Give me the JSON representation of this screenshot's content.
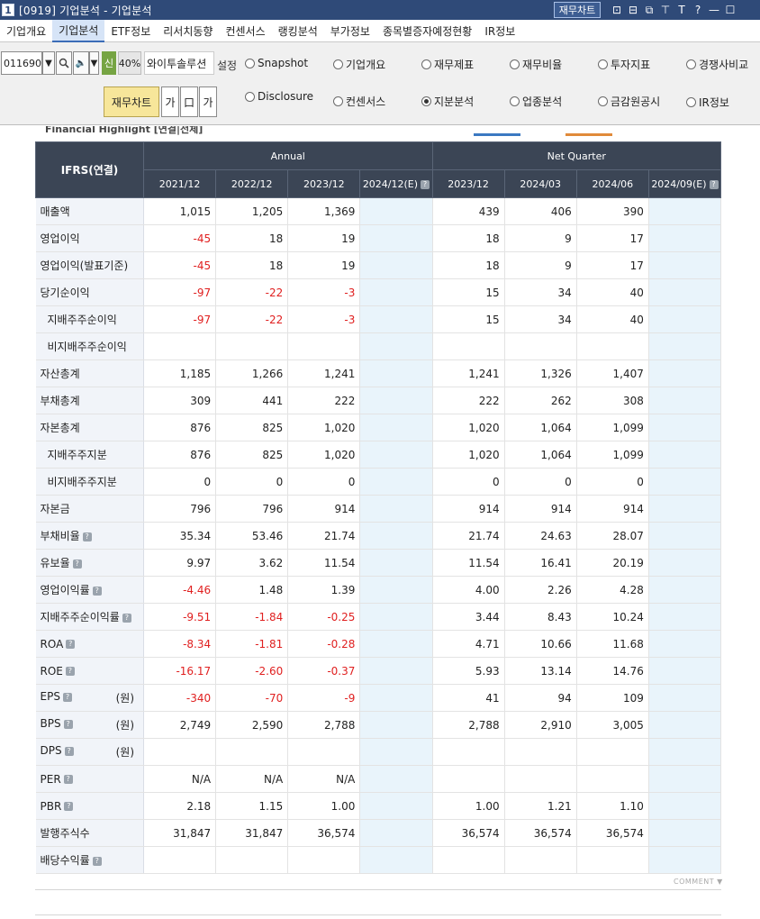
{
  "window": {
    "screen_no": "1",
    "title": "[0919] 기업분석 - 기업분석",
    "fin_chart_button": "재무차트",
    "icons": [
      "chart-icon",
      "layout-icon",
      "copy-icon",
      "pin-icon",
      "font-icon",
      "help-icon",
      "minimize-icon",
      "close-icon"
    ],
    "icon_glyphs": [
      "⊡",
      "⊟",
      "⧉",
      "⊤",
      "T",
      "?",
      "—",
      "☐"
    ]
  },
  "menu": {
    "items": [
      "기업개요",
      "기업분석",
      "ETF정보",
      "리서치동향",
      "컨센서스",
      "랭킹분석",
      "부가정보",
      "종목별증자예정현황",
      "IR정보"
    ],
    "active_index": 1
  },
  "controls": {
    "code": "011690",
    "new_badge": "신",
    "percent": "40%",
    "company": "와이투솔루션",
    "setting": "설정",
    "fin_chart_button": "재무차트",
    "tool_ga1": "가",
    "tool_box": "口",
    "tool_ga2": "가",
    "radios_row1": [
      "Snapshot",
      "기업개요",
      "재무제표",
      "재무비율",
      "투자지표",
      "경쟁사비교"
    ],
    "radios_row2": [
      "Disclosure",
      "컨센서스",
      "지분분석",
      "업종분석",
      "금감원공시",
      "IR정보"
    ],
    "selected": "지분분석"
  },
  "header_strip": "Financial Highlight [연결|전체]",
  "table": {
    "corner": "IFRS(연결)",
    "group_annual": "Annual",
    "group_quarter": "Net Quarter",
    "columns": [
      "2021/12",
      "2022/12",
      "2023/12",
      "2024/12(E)",
      "2023/12",
      "2024/03",
      "2024/06",
      "2024/09(E)"
    ],
    "est_columns": [
      3,
      7
    ],
    "rows": [
      {
        "label": "매출액",
        "indent": false,
        "help": false,
        "unit": "",
        "values": [
          "1,015",
          "1,205",
          "1,369",
          "",
          "439",
          "406",
          "390",
          ""
        ]
      },
      {
        "label": "영업이익",
        "indent": false,
        "help": false,
        "unit": "",
        "values": [
          "-45",
          "18",
          "19",
          "",
          "18",
          "9",
          "17",
          ""
        ]
      },
      {
        "label": "영업이익(발표기준)",
        "indent": false,
        "help": false,
        "unit": "",
        "values": [
          "-45",
          "18",
          "19",
          "",
          "18",
          "9",
          "17",
          ""
        ]
      },
      {
        "label": "당기순이익",
        "indent": false,
        "help": false,
        "unit": "",
        "values": [
          "-97",
          "-22",
          "-3",
          "",
          "15",
          "34",
          "40",
          ""
        ]
      },
      {
        "label": "지배주주순이익",
        "indent": true,
        "help": false,
        "unit": "",
        "values": [
          "-97",
          "-22",
          "-3",
          "",
          "15",
          "34",
          "40",
          ""
        ]
      },
      {
        "label": "비지배주주순이익",
        "indent": true,
        "help": false,
        "unit": "",
        "values": [
          "",
          "",
          "",
          "",
          "",
          "",
          "",
          ""
        ]
      },
      {
        "label": "자산총계",
        "indent": false,
        "help": false,
        "unit": "",
        "values": [
          "1,185",
          "1,266",
          "1,241",
          "",
          "1,241",
          "1,326",
          "1,407",
          ""
        ]
      },
      {
        "label": "부채총계",
        "indent": false,
        "help": false,
        "unit": "",
        "values": [
          "309",
          "441",
          "222",
          "",
          "222",
          "262",
          "308",
          ""
        ]
      },
      {
        "label": "자본총계",
        "indent": false,
        "help": false,
        "unit": "",
        "values": [
          "876",
          "825",
          "1,020",
          "",
          "1,020",
          "1,064",
          "1,099",
          ""
        ]
      },
      {
        "label": "지배주주지분",
        "indent": true,
        "help": false,
        "unit": "",
        "values": [
          "876",
          "825",
          "1,020",
          "",
          "1,020",
          "1,064",
          "1,099",
          ""
        ]
      },
      {
        "label": "비지배주주지분",
        "indent": true,
        "help": false,
        "unit": "",
        "values": [
          "0",
          "0",
          "0",
          "",
          "0",
          "0",
          "0",
          ""
        ]
      },
      {
        "label": "자본금",
        "indent": false,
        "help": false,
        "unit": "",
        "values": [
          "796",
          "796",
          "914",
          "",
          "914",
          "914",
          "914",
          ""
        ]
      },
      {
        "label": "부채비율",
        "indent": false,
        "help": true,
        "unit": "",
        "values": [
          "35.34",
          "53.46",
          "21.74",
          "",
          "21.74",
          "24.63",
          "28.07",
          ""
        ]
      },
      {
        "label": "유보율",
        "indent": false,
        "help": true,
        "unit": "",
        "values": [
          "9.97",
          "3.62",
          "11.54",
          "",
          "11.54",
          "16.41",
          "20.19",
          ""
        ]
      },
      {
        "label": "영업이익률",
        "indent": false,
        "help": true,
        "unit": "",
        "values": [
          "-4.46",
          "1.48",
          "1.39",
          "",
          "4.00",
          "2.26",
          "4.28",
          ""
        ]
      },
      {
        "label": "지배주주순이익률",
        "indent": false,
        "help": true,
        "unit": "",
        "values": [
          "-9.51",
          "-1.84",
          "-0.25",
          "",
          "3.44",
          "8.43",
          "10.24",
          ""
        ]
      },
      {
        "label": "ROA",
        "indent": false,
        "help": true,
        "unit": "",
        "values": [
          "-8.34",
          "-1.81",
          "-0.28",
          "",
          "4.71",
          "10.66",
          "11.68",
          ""
        ]
      },
      {
        "label": "ROE",
        "indent": false,
        "help": true,
        "unit": "",
        "values": [
          "-16.17",
          "-2.60",
          "-0.37",
          "",
          "5.93",
          "13.14",
          "14.76",
          ""
        ]
      },
      {
        "label": "EPS",
        "indent": false,
        "help": true,
        "unit": "(원)",
        "values": [
          "-340",
          "-70",
          "-9",
          "",
          "41",
          "94",
          "109",
          ""
        ]
      },
      {
        "label": "BPS",
        "indent": false,
        "help": true,
        "unit": "(원)",
        "values": [
          "2,749",
          "2,590",
          "2,788",
          "",
          "2,788",
          "2,910",
          "3,005",
          ""
        ]
      },
      {
        "label": "DPS",
        "indent": false,
        "help": true,
        "unit": "(원)",
        "values": [
          "",
          "",
          "",
          "",
          "",
          "",
          "",
          ""
        ]
      },
      {
        "label": "PER",
        "indent": false,
        "help": true,
        "unit": "",
        "values": [
          "N/A",
          "N/A",
          "N/A",
          "",
          "",
          "",
          "",
          ""
        ]
      },
      {
        "label": "PBR",
        "indent": false,
        "help": true,
        "unit": "",
        "values": [
          "2.18",
          "1.15",
          "1.00",
          "",
          "1.00",
          "1.21",
          "1.10",
          ""
        ]
      },
      {
        "label": "발행주식수",
        "indent": false,
        "help": false,
        "unit": "",
        "values": [
          "31,847",
          "31,847",
          "36,574",
          "",
          "36,574",
          "36,574",
          "36,574",
          ""
        ]
      },
      {
        "label": "배당수익률",
        "indent": false,
        "help": true,
        "unit": "",
        "values": [
          "",
          "",
          "",
          "",
          "",
          "",
          "",
          ""
        ]
      }
    ]
  },
  "comment_label": "COMMENT ▼",
  "colors": {
    "titlebar": "#2f4a78",
    "header": "#3b4555",
    "negative": "#e02020",
    "estimate_col": "#e9f4fb",
    "label_col": "#f1f4f9"
  }
}
